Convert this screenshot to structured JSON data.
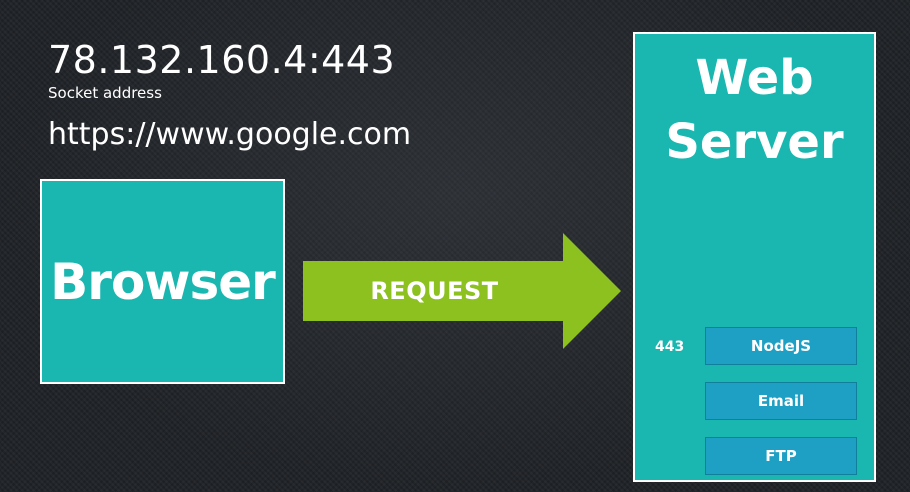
{
  "socket": {
    "address": "78.132.160.4:443",
    "caption": "Socket address"
  },
  "url": "https://www.google.com",
  "browser": {
    "label": "Browser"
  },
  "request": {
    "label": "REQUEST"
  },
  "server": {
    "title_line1": "Web",
    "title_line2": "Server",
    "port": "443",
    "services": [
      "NodeJS",
      "Email",
      "FTP"
    ]
  },
  "colors": {
    "box_teal": "#1ab6b0",
    "service_blue": "#1ea0c4",
    "arrow_green": "#8cc11f",
    "background": "#1f2226"
  }
}
